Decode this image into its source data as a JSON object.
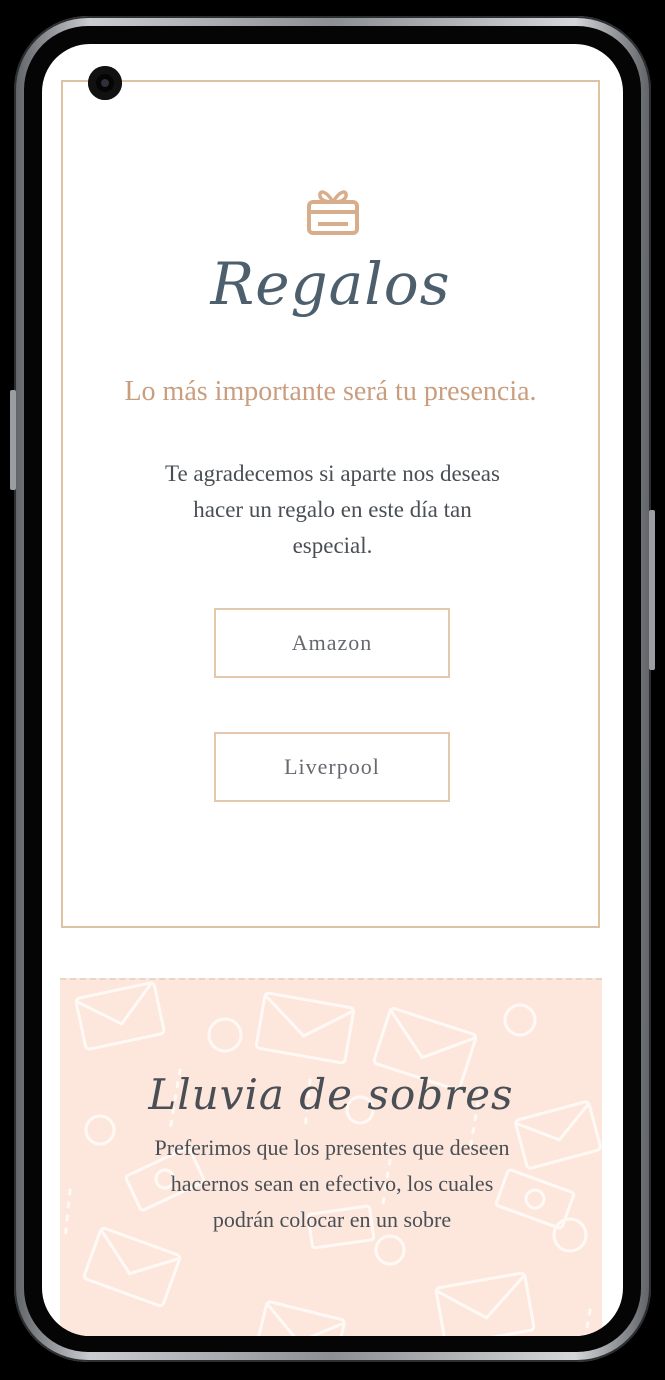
{
  "gifts": {
    "icon": "gift-card-icon",
    "title": "Regalos",
    "subtitle": "Lo más importante será tu presencia.",
    "description": "Te agradecemos si aparte nos deseas hacer un regalo en este día tan especial.",
    "buttons": [
      {
        "label": "Amazon"
      },
      {
        "label": "Liverpool"
      }
    ]
  },
  "envelopes": {
    "title": "Lluvia de sobres",
    "description": "Preferimos que los presentes que deseen hacernos sean en efectivo, los cuales podrán colocar en un sobre"
  },
  "colors": {
    "accent": "#c99d7e",
    "border": "#ddc2a4",
    "title": "#4d5f6d",
    "text": "#4a4f56",
    "envelope_bg": "#fde7dc"
  }
}
